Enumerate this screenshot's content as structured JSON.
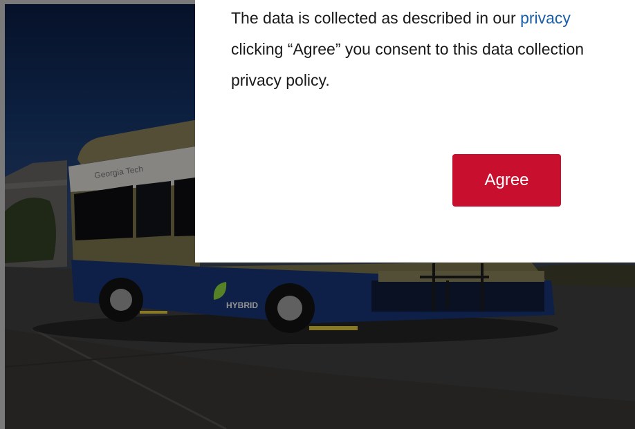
{
  "consent": {
    "line1_pre": "The data is collected as described in our ",
    "line1_link": "privacy",
    "line2": "clicking “Agree” you consent to this data collection",
    "line3": "privacy policy.",
    "agree_label": "Agree"
  },
  "background": {
    "bus_brand": "Georgia Tech",
    "bus_badge": "HYBRID"
  },
  "colors": {
    "agree_button": "#c8102e",
    "link": "#1a5fa8",
    "modal_bg": "#ffffff"
  }
}
